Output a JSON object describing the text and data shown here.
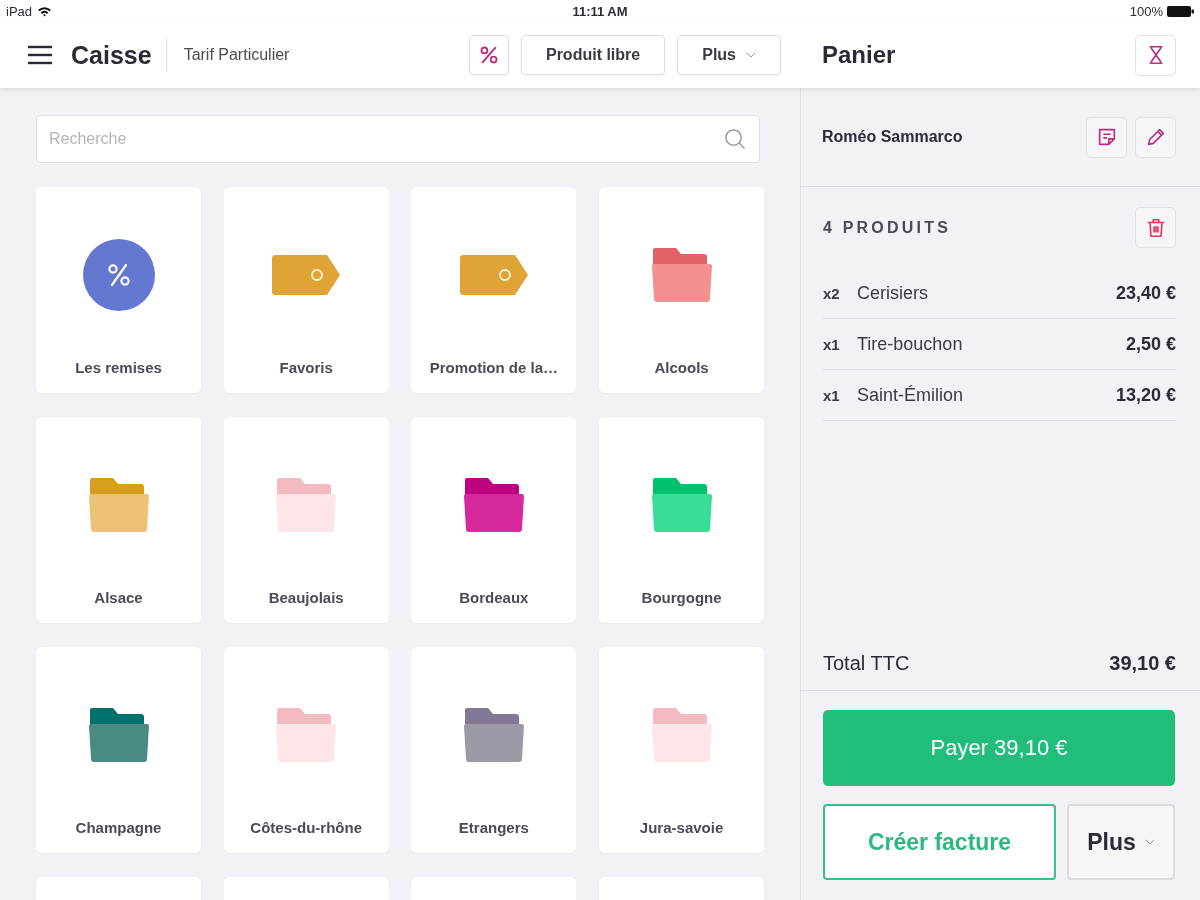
{
  "status_bar": {
    "device": "iPad",
    "time": "11:11 AM",
    "battery": "100%"
  },
  "header": {
    "title": "Caisse",
    "price_list": "Tarif Particulier",
    "actions": [
      {
        "kind": "discount"
      },
      {
        "kind": "button",
        "label": "Produit libre"
      },
      {
        "kind": "dropdown",
        "label": "Plus"
      }
    ]
  },
  "search": {
    "placeholder": "Recherche"
  },
  "tiles": [
    {
      "kind": "discount",
      "label": "Les remises",
      "color": "#6478d0"
    },
    {
      "kind": "tag",
      "label": "Favoris",
      "color": "#e0a436"
    },
    {
      "kind": "tag",
      "label": "Promotion de la…",
      "color": "#e0a436"
    },
    {
      "kind": "folder",
      "label": "Alcools",
      "color": "#f39090"
    },
    {
      "kind": "folder",
      "label": "Alsace",
      "color": "#ebc277"
    },
    {
      "kind": "folder",
      "label": "Beaujolais",
      "color": "#fde5e8"
    },
    {
      "kind": "folder",
      "label": "Bordeaux",
      "color": "#d62a9c"
    },
    {
      "kind": "folder",
      "label": "Bourgogne",
      "color": "#38dd96"
    },
    {
      "kind": "folder",
      "label": "Champagne",
      "color": "#4a8984"
    },
    {
      "kind": "folder",
      "label": "Côtes-du-rhône",
      "color": "#fde5e8"
    },
    {
      "kind": "folder",
      "label": "Etrangers",
      "color": "#9d99a5"
    },
    {
      "kind": "folder",
      "label": "Jura-savoie",
      "color": "#fde5e8"
    },
    {
      "kind": "blank"
    },
    {
      "kind": "blank"
    },
    {
      "kind": "blank"
    },
    {
      "kind": "blank"
    }
  ],
  "cart": {
    "title": "Panier",
    "customer": "Roméo Sammarco",
    "count_label": "4 PRODUITS",
    "lines": [
      {
        "quantity": "x2",
        "name": "Cerisiers",
        "price": "23,40 €"
      },
      {
        "quantity": "x1",
        "name": "Tire-bouchon",
        "price": "2,50 €"
      },
      {
        "quantity": "x1",
        "name": "Saint-Émilion",
        "price": "13,20 €"
      }
    ],
    "total_label": "Total TTC",
    "total": "39,10 €",
    "pay_label": "Payer 39,10 €",
    "invoice_label": "Créer facture",
    "more_label": "Plus"
  }
}
